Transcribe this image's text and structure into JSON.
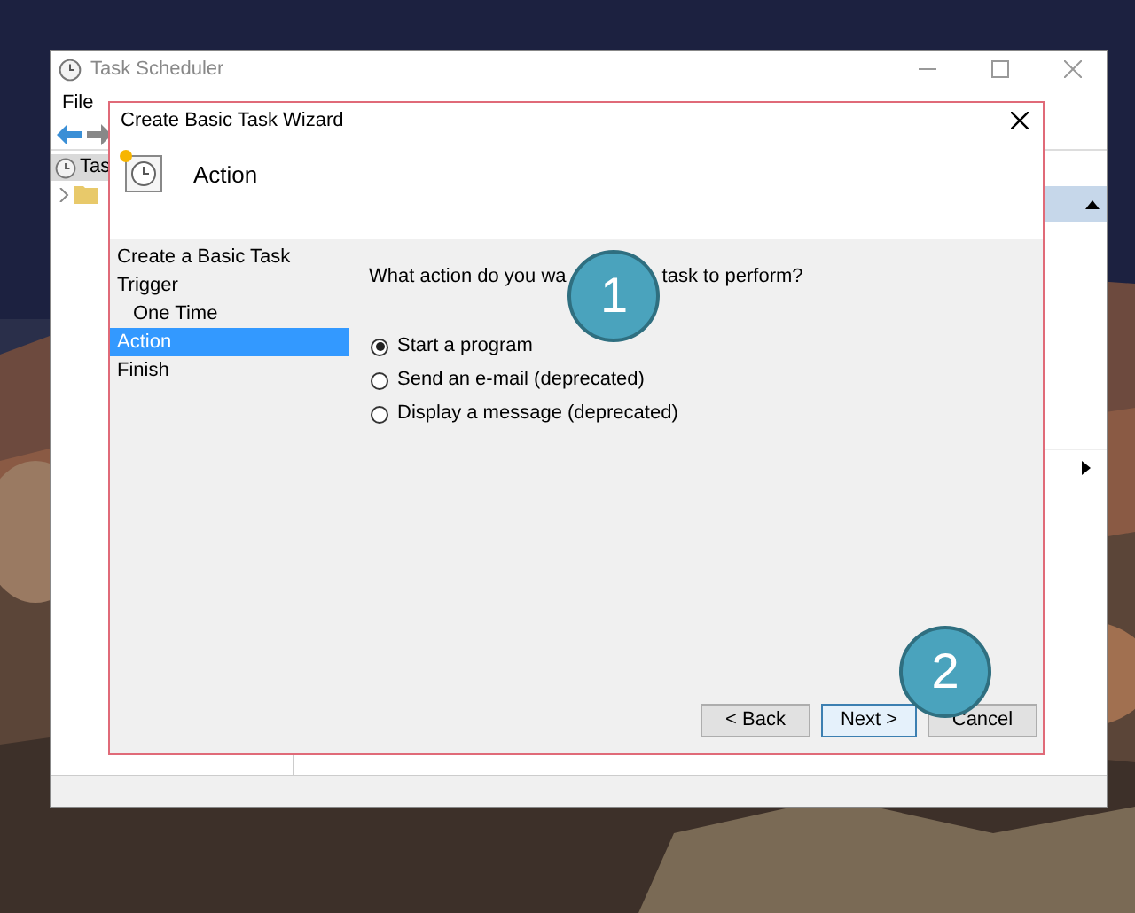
{
  "background_window": {
    "title": "Task Scheduler",
    "menu": [
      "File"
    ],
    "tree": [
      {
        "label": "Tas",
        "selected": true
      }
    ]
  },
  "dialog": {
    "title": "Create Basic Task Wizard",
    "heading": "Action",
    "steps": [
      {
        "label": "Create a Basic Task",
        "selected": false
      },
      {
        "label": "Trigger",
        "selected": false,
        "children": [
          {
            "label": "One Time",
            "selected": false
          }
        ]
      },
      {
        "label": "Action",
        "selected": true
      },
      {
        "label": "Finish",
        "selected": false
      }
    ],
    "question_start": "What action do you wa",
    "question_end": "task to perform?",
    "options": [
      {
        "label": "Start a program",
        "selected": true
      },
      {
        "label": "Send an e-mail (deprecated)",
        "selected": false
      },
      {
        "label": "Display a message (deprecated)",
        "selected": false
      }
    ],
    "buttons": [
      {
        "label": "< Back",
        "default": false
      },
      {
        "label": "Next >",
        "default": true
      },
      {
        "label": "Cancel",
        "default": false
      }
    ]
  },
  "annotations": [
    {
      "number": "1"
    },
    {
      "number": "2"
    }
  ]
}
